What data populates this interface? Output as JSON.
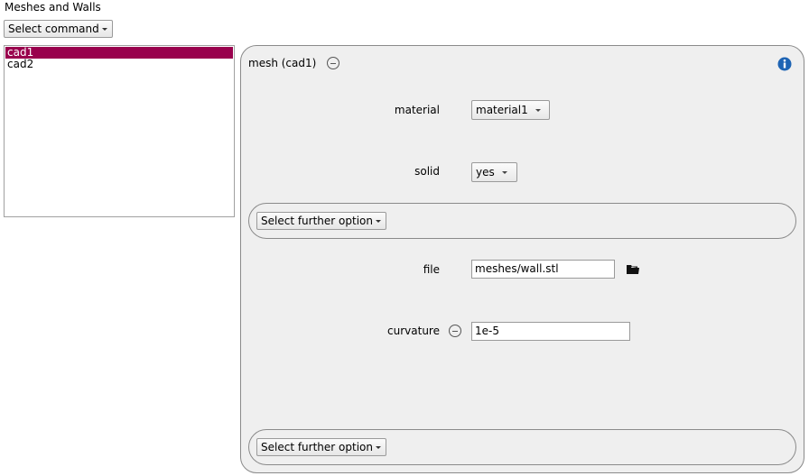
{
  "header": {
    "title": "Meshes and Walls",
    "command_label": "Select command"
  },
  "list": {
    "items": [
      {
        "label": "cad1",
        "selected": true
      },
      {
        "label": "cad2",
        "selected": false
      }
    ]
  },
  "panel": {
    "title": "mesh (cad1)",
    "material": {
      "label": "material",
      "value": "material1"
    },
    "solid": {
      "label": "solid",
      "value": "yes"
    },
    "further_option_1": "Select further option",
    "file": {
      "label": "file",
      "value": "meshes/wall.stl"
    },
    "curvature": {
      "label": "curvature",
      "value": "1e-5"
    },
    "further_option_2": "Select further option"
  },
  "colors": {
    "selection": "#99004d",
    "info": "#1e64b4"
  }
}
